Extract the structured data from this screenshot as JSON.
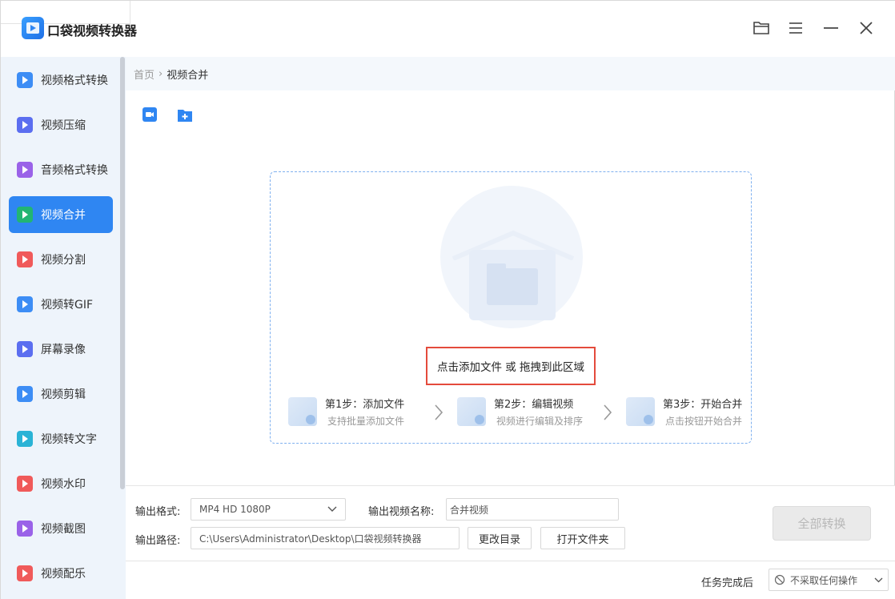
{
  "app": {
    "title": "口袋视频转换器"
  },
  "sidebar": {
    "items": [
      {
        "label": "视频格式转换",
        "color": "#3d8df5",
        "active": false
      },
      {
        "label": "视频压缩",
        "color": "#5b6ef0",
        "active": false
      },
      {
        "label": "音频格式转换",
        "color": "#9a62e8",
        "active": false
      },
      {
        "label": "视频合并",
        "color": "#22b573",
        "active": true
      },
      {
        "label": "视频分割",
        "color": "#f05a5a",
        "active": false
      },
      {
        "label": "视频转GIF",
        "color": "#3d8df5",
        "active": false
      },
      {
        "label": "屏幕录像",
        "color": "#5b6ef0",
        "active": false
      },
      {
        "label": "视频剪辑",
        "color": "#3d8df5",
        "active": false
      },
      {
        "label": "视频转文字",
        "color": "#2ab3d6",
        "active": false
      },
      {
        "label": "视频水印",
        "color": "#f05a5a",
        "active": false
      },
      {
        "label": "视频截图",
        "color": "#9a62e8",
        "active": false
      },
      {
        "label": "视频配乐",
        "color": "#f05a5a",
        "active": false
      }
    ]
  },
  "breadcrumb": {
    "home": "首页",
    "separator": "›",
    "current": "视频合并"
  },
  "dropzone": {
    "hint": "点击添加文件 或 拖拽到此区域",
    "steps": [
      {
        "title": "第1步：添加文件",
        "desc": "支持批量添加文件"
      },
      {
        "title": "第2步：编辑视频",
        "desc": "视频进行编辑及排序"
      },
      {
        "title": "第3步：开始合并",
        "desc": "点击按钮开始合并"
      }
    ]
  },
  "output": {
    "format_label": "输出格式:",
    "format_value": "MP4   HD 1080P",
    "name_label": "输出视频名称:",
    "name_value": "合并视频",
    "path_label": "输出路径:",
    "path_value": "C:\\Users\\Administrator\\Desktop\\口袋视频转换器",
    "change_dir": "更改目录",
    "open_folder": "打开文件夹",
    "convert_all": "全部转换"
  },
  "footer": {
    "after_label": "任务完成后",
    "after_value": "不采取任何操作"
  },
  "colors": {
    "accent": "#2f86f2",
    "sidebar_bg": "#eef4fb",
    "highlight_border": "#e44b3c"
  }
}
